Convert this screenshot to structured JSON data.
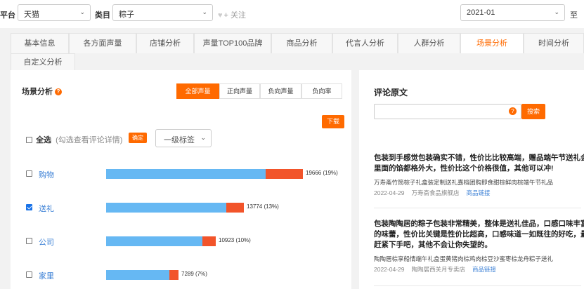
{
  "filters": {
    "platform_label": "平台",
    "platform_value": "天猫",
    "category_label": "类目",
    "category_value": "粽子",
    "follow_label": "+ 关注",
    "date_value": "2021-01",
    "date_to_label": "至"
  },
  "tabs": [
    {
      "label": "基本信息",
      "active": false
    },
    {
      "label": "各方面声量",
      "active": false
    },
    {
      "label": "店铺分析",
      "active": false
    },
    {
      "label": "声量TOP100品牌",
      "active": false
    },
    {
      "label": "商品分析",
      "active": false
    },
    {
      "label": "代言人分析",
      "active": false
    },
    {
      "label": "人群分析",
      "active": false
    },
    {
      "label": "场景分析",
      "active": true
    },
    {
      "label": "时间分析",
      "active": false
    },
    {
      "label": "自定义分析",
      "active": false
    }
  ],
  "scene": {
    "title": "场景分析",
    "segments": [
      "全部声量",
      "正向声量",
      "负向声量",
      "负向率"
    ],
    "active_segment": 0,
    "download_label": "下载",
    "select_all_label": "全选",
    "select_hint": "(勾选查看评论详情)",
    "confirm_label": "确定",
    "level_select": "一级标签",
    "rows": [
      {
        "label": "购物",
        "checked": false,
        "positive": 15930,
        "negative": 3736,
        "total": 19666,
        "value_label": "19666 (19%)"
      },
      {
        "label": "送礼",
        "checked": true,
        "positive": 11983,
        "negative": 1791,
        "total": 13774,
        "value_label": "13774 (13%)"
      },
      {
        "label": "公司",
        "checked": false,
        "positive": 9612,
        "negative": 1311,
        "total": 10923,
        "value_label": "10923 (10%)"
      },
      {
        "label": "家里",
        "checked": false,
        "positive": 6341,
        "negative": 948,
        "total": 7289,
        "value_label": "7289 (7%)"
      }
    ],
    "scale_max": 19666
  },
  "reviews": {
    "title": "评论原文",
    "search_placeholder": "",
    "search_button": "搜索",
    "items": [
      {
        "lines": [
          "包装到手感觉包装确实不错，性价比比较高端，赠品端午节送礼会",
          "里面的馅都格外大，性价比这个价格很值，其他可以冲!"
        ],
        "product": "万寿斋竹筒棕子礼盒装定制送礼嘉档团购即食甜棕鲜肉棕端午节礼品",
        "date": "2022-04-29",
        "shop": "万寿斋食品旗舰店",
        "link": "商品链接"
      },
      {
        "lines": [
          "包装陶陶居的粽子包装非常精美，整体是送礼佳品，口感口味丰富",
          "的味蕾，性价比关键是性价比超高，口感味道一如既往的好吃，量",
          "赶紧下手吧，其他不会让你失望的。"
        ],
        "product": "陶陶居棕享船情端午礼盒蛋黄猪肉棕鸡肉棕豆沙蜜枣棕龙舟粽子送礼",
        "date": "2022-04-29",
        "shop": "陶陶居西关月专卖店",
        "link": "商品链接"
      }
    ]
  },
  "colors": {
    "accent": "#ff6a00",
    "positive": "#66b8f3",
    "negative": "#f2542a",
    "link": "#3a7fd5"
  }
}
